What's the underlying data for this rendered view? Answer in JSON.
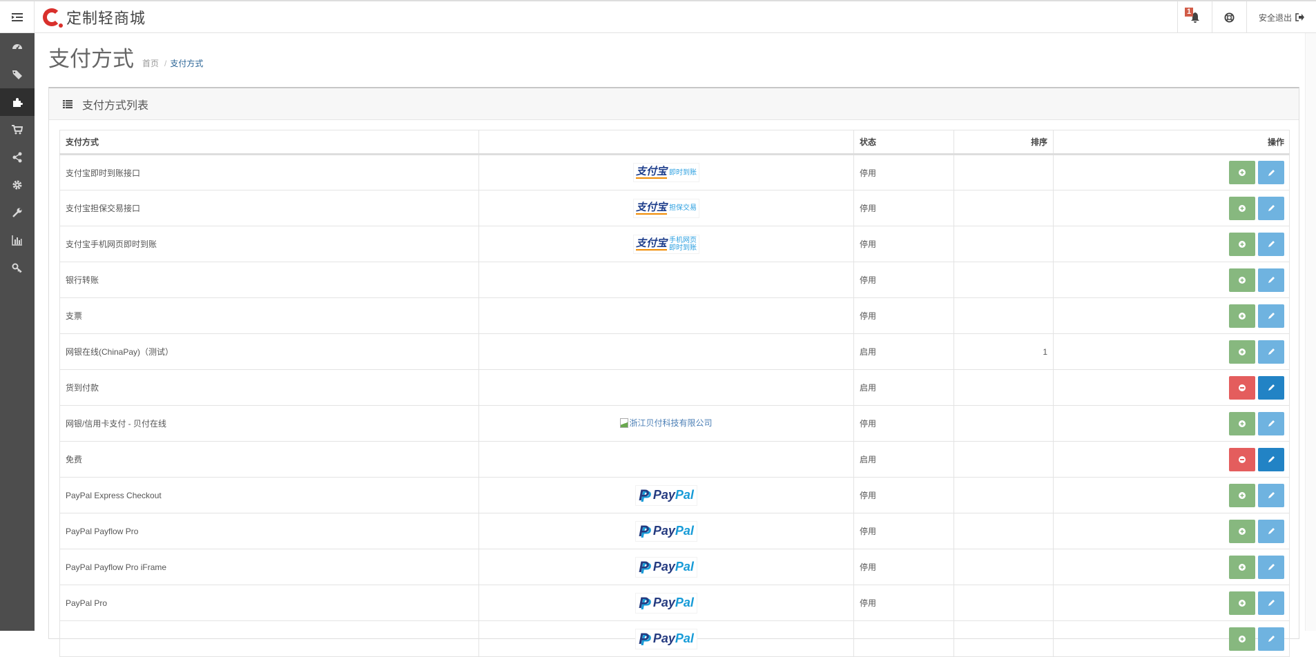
{
  "header": {
    "brand": "定制轻商城",
    "notification_count": "1",
    "logout_label": "安全退出"
  },
  "sidebar": {
    "items": [
      {
        "icon": "dashboard-icon"
      },
      {
        "icon": "tags-icon"
      },
      {
        "icon": "puzzle-icon",
        "active": true
      },
      {
        "icon": "cart-icon"
      },
      {
        "icon": "share-icon"
      },
      {
        "icon": "gear-icon"
      },
      {
        "icon": "wrench-icon"
      },
      {
        "icon": "bar-chart-icon"
      },
      {
        "icon": "key-icon"
      }
    ]
  },
  "page": {
    "title": "支付方式",
    "breadcrumb": {
      "home": "首页",
      "sep": "/",
      "current": "支付方式"
    }
  },
  "panel": {
    "title": "支付方式列表"
  },
  "table": {
    "headers": [
      "支付方式",
      "",
      "状态",
      "排序",
      "操作"
    ],
    "rows": [
      {
        "name": "支付宝即时到账接口",
        "logo": {
          "type": "alipay",
          "main": "支付宝",
          "sub": "即时到账"
        },
        "status": "停用",
        "sort": "",
        "enabled": false
      },
      {
        "name": "支付宝担保交易接口",
        "logo": {
          "type": "alipay",
          "main": "支付宝",
          "sub": "担保交易"
        },
        "status": "停用",
        "sort": "",
        "enabled": false
      },
      {
        "name": "支付宝手机网页即时到账",
        "logo": {
          "type": "alipay",
          "main": "支付宝",
          "sub": "手机网页 即时到账"
        },
        "status": "停用",
        "sort": "",
        "enabled": false
      },
      {
        "name": "银行转账",
        "logo": null,
        "status": "停用",
        "sort": "",
        "enabled": false
      },
      {
        "name": "支票",
        "logo": null,
        "status": "停用",
        "sort": "",
        "enabled": false
      },
      {
        "name": "网银在线(ChinaPay)（测试）",
        "logo": null,
        "status": "启用",
        "sort": "1",
        "enabled": false
      },
      {
        "name": "货到付款",
        "logo": null,
        "status": "启用",
        "sort": "",
        "enabled": true
      },
      {
        "name": "网银/信用卡支付 - 贝付在线",
        "logo": {
          "type": "broken",
          "alt": "浙江贝付科技有限公司"
        },
        "status": "停用",
        "sort": "",
        "enabled": false
      },
      {
        "name": "免费",
        "logo": null,
        "status": "启用",
        "sort": "",
        "enabled": true
      },
      {
        "name": "PayPal Express Checkout",
        "logo": {
          "type": "paypal",
          "a": "Pay",
          "b": "Pal"
        },
        "status": "停用",
        "sort": "",
        "enabled": false
      },
      {
        "name": "PayPal Payflow Pro",
        "logo": {
          "type": "paypal",
          "a": "Pay",
          "b": "Pal"
        },
        "status": "停用",
        "sort": "",
        "enabled": false
      },
      {
        "name": "PayPal Payflow Pro iFrame",
        "logo": {
          "type": "paypal",
          "a": "Pay",
          "b": "Pal"
        },
        "status": "停用",
        "sort": "",
        "enabled": false
      },
      {
        "name": "PayPal Pro",
        "logo": {
          "type": "paypal",
          "a": "Pay",
          "b": "Pal"
        },
        "status": "停用",
        "sort": "",
        "enabled": false
      },
      {
        "name": "",
        "logo": {
          "type": "paypal",
          "a": "Pay",
          "b": "Pal"
        },
        "status": "",
        "sort": "",
        "enabled": false
      }
    ]
  },
  "colors": {
    "green": "#87b87f",
    "blue": "#6fb3e0",
    "red": "#e45d5d",
    "dark_blue": "#2283c5",
    "sidebar": "#4d4d4d"
  }
}
